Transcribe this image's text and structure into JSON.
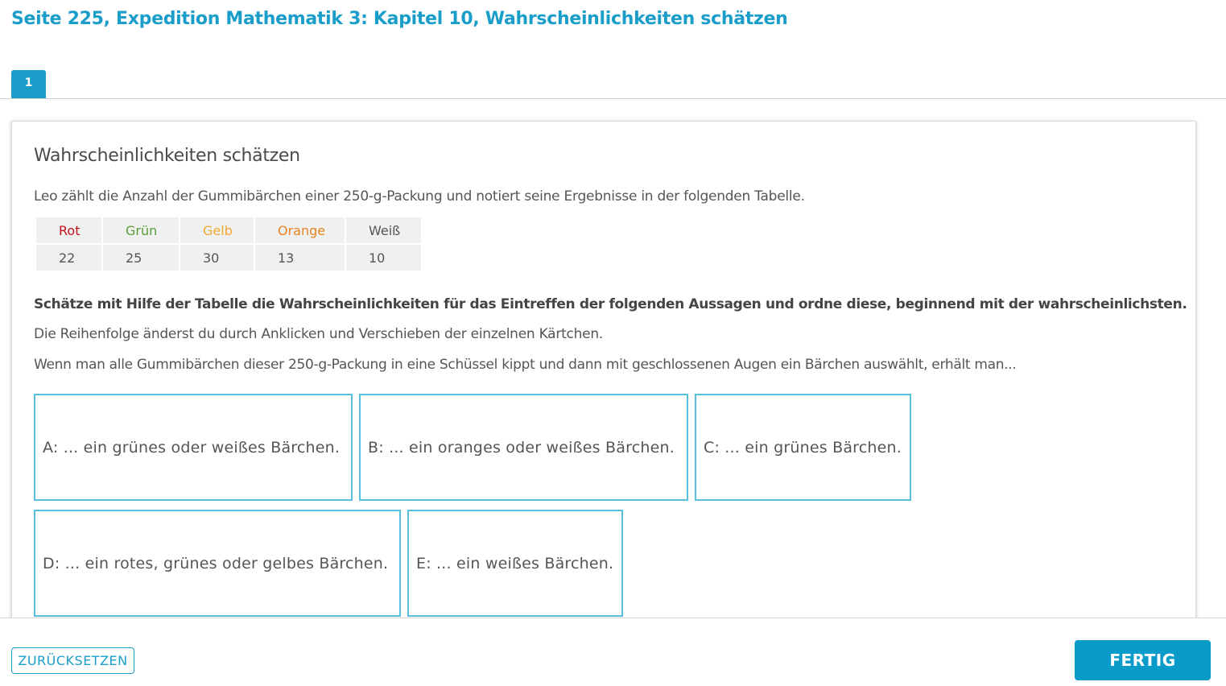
{
  "page": {
    "title": "Seite 225, Expedition Mathematik 3: Kapitel 10, Wahrscheinlichkeiten schätzen"
  },
  "tabs": [
    {
      "label": "1",
      "active": true
    }
  ],
  "exercise": {
    "heading": "Wahrscheinlichkeiten schätzen",
    "intro": "Leo zählt die Anzahl der Gummibärchen einer 250-g-Packung und notiert seine Ergebnisse in der folgenden Tabelle.",
    "table": {
      "headers": [
        {
          "label": "Rot",
          "color": "#c0111f"
        },
        {
          "label": "Grün",
          "color": "#5a9e3a"
        },
        {
          "label": "Gelb",
          "color": "#f0a830"
        },
        {
          "label": "Orange",
          "color": "#e8821e"
        },
        {
          "label": "Weiß",
          "color": "#555555"
        }
      ],
      "values": [
        "22",
        "25",
        "30",
        "13",
        "10"
      ]
    },
    "task_bold": "Schätze mit Hilfe der Tabelle die Wahrscheinlichkeiten für das Eintreffen der folgenden Aussagen und ordne diese, beginnend mit der wahrscheinlichsten.",
    "task_hint": "Die Reihenfolge änderst du durch Anklicken und Verschieben der einzelnen Kärtchen.",
    "task_lead": "Wenn man alle Gummibärchen dieser 250-g-Packung in eine Schüssel kippt und dann mit geschlossenen Augen ein Bärchen auswählt, erhält man...",
    "cards": [
      {
        "label": "A: ... ein grünes oder weißes Bärchen."
      },
      {
        "label": "B: ... ein oranges oder weißes Bärchen."
      },
      {
        "label": "C: ... ein grünes Bärchen."
      },
      {
        "label": "D: ... ein rotes, grünes oder gelbes Bärchen."
      },
      {
        "label": "E: ... ein weißes Bärchen."
      }
    ]
  },
  "footer": {
    "reset_label": "ZURÜCKSETZEN",
    "done_label": "FERTIG"
  },
  "colors": {
    "accent": "#1a9ec9",
    "card_border": "#58bfdc",
    "done_button": "#0a9bcb"
  }
}
